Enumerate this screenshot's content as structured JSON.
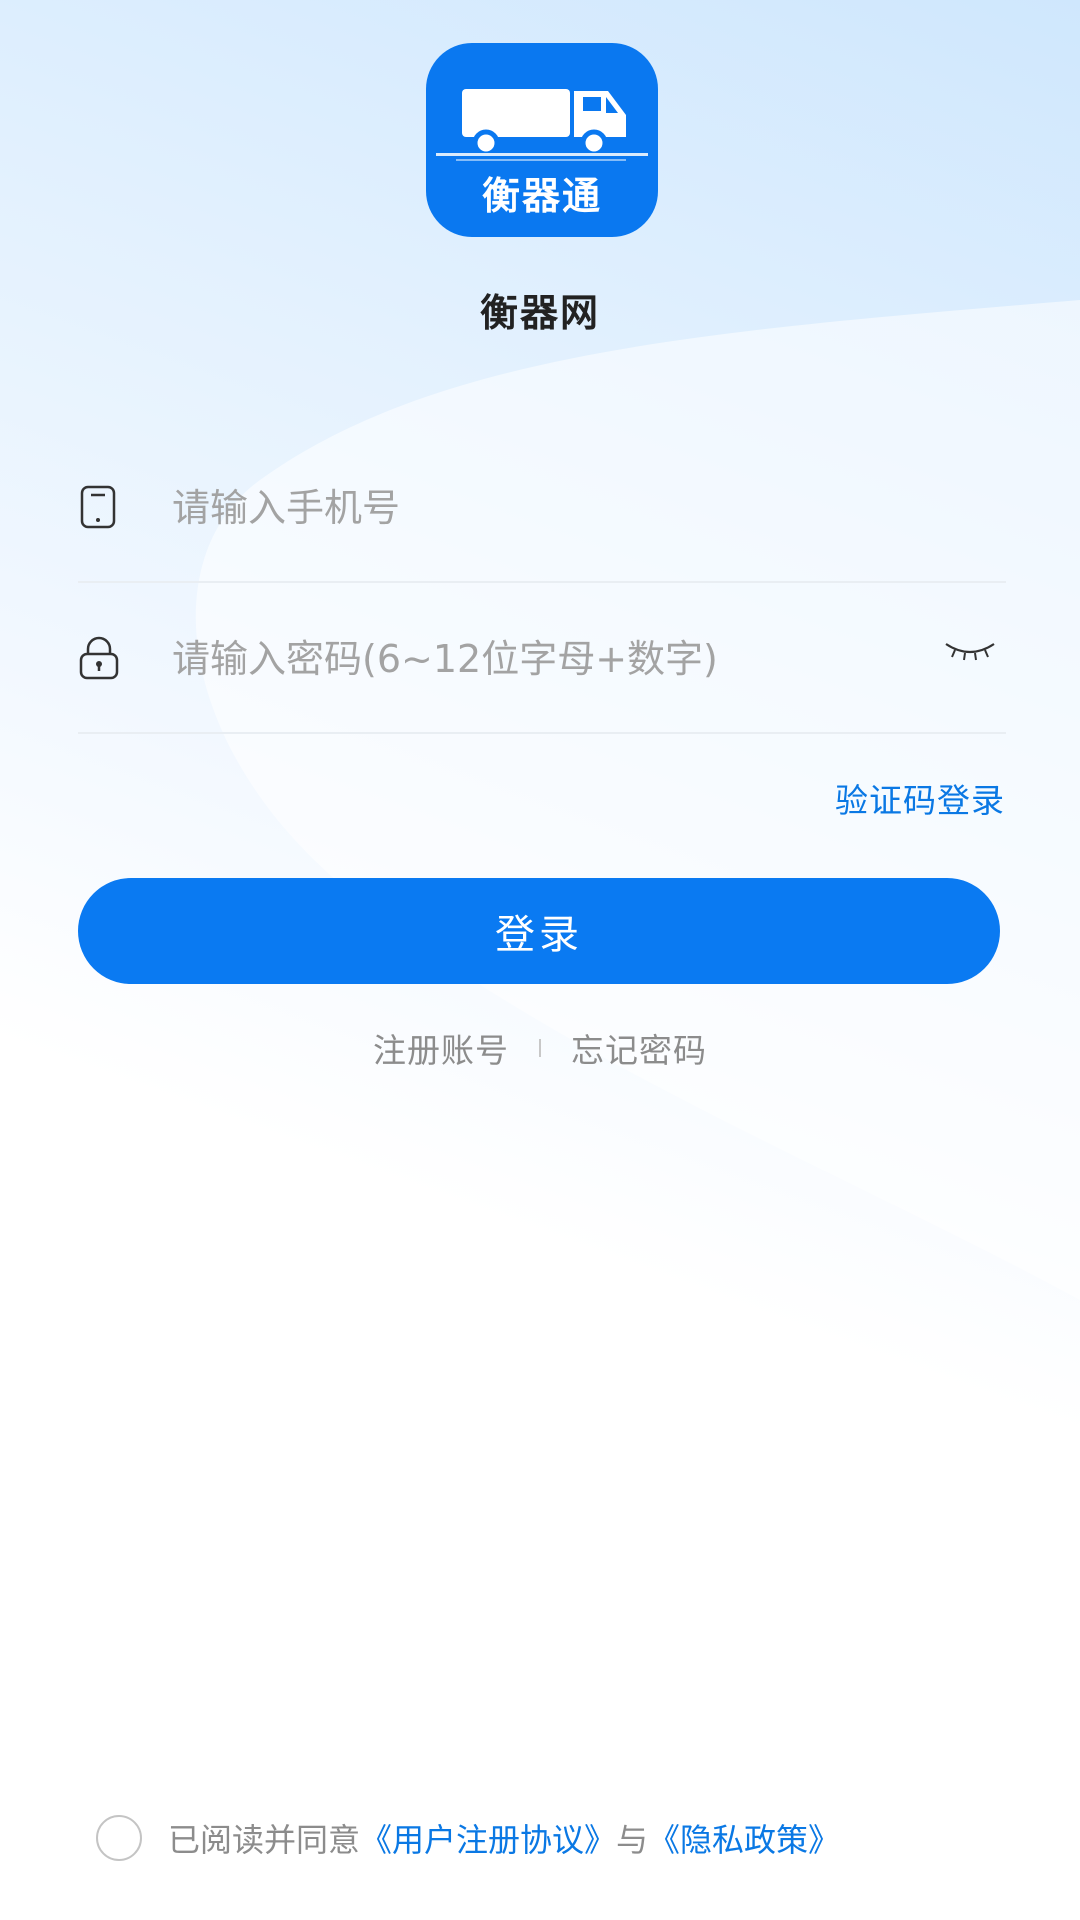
{
  "logo": {
    "text": "衡器通"
  },
  "app_name": "衡器网",
  "phone": {
    "placeholder": "请输入手机号",
    "value": ""
  },
  "password": {
    "placeholder": "请输入密码(6~12位字母+数字)",
    "value": ""
  },
  "sms_login_label": "验证码登录",
  "login_button_label": "登录",
  "links": {
    "register": "注册账号",
    "forgot": "忘记密码"
  },
  "agreement": {
    "prefix": "已阅读并同意",
    "user_agreement": "《用户注册协议》",
    "conjunction": "与",
    "privacy_policy": "《隐私政策》",
    "checked": false
  },
  "icons": {
    "phone": "phone-icon",
    "lock": "lock-icon",
    "eye": "eye-closed-icon",
    "truck": "truck-icon"
  },
  "colors": {
    "primary": "#0a7af2",
    "link": "#0a78e4",
    "placeholder": "#a3a3a3",
    "secondary_text": "#8c8c8c"
  }
}
